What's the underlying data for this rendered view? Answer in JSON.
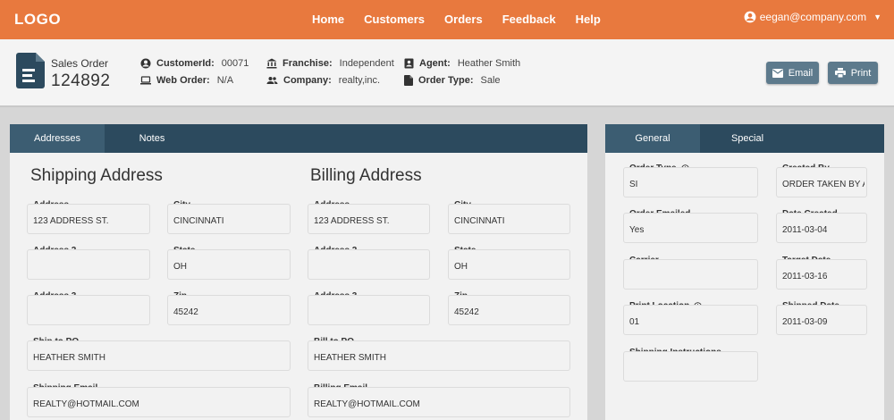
{
  "nav": {
    "logo": "LOGO",
    "links": [
      "Home",
      "Customers",
      "Orders",
      "Feedback",
      "Help"
    ],
    "user_email": "eegan@company.com"
  },
  "order": {
    "type_label": "Sales Order",
    "number": "124892",
    "customer_id": {
      "label": "CustomerId:",
      "value": "00071"
    },
    "web_order": {
      "label": "Web Order:",
      "value": "N/A"
    },
    "franchise": {
      "label": "Franchise:",
      "value": "Independent"
    },
    "company": {
      "label": "Company:",
      "value": "realty,inc."
    },
    "agent": {
      "label": "Agent:",
      "value": "Heather Smith"
    },
    "order_type": {
      "label": "Order Type:",
      "value": "Sale"
    },
    "email_button": "Email",
    "print_button": "Print"
  },
  "left_tabs": [
    "Addresses",
    "Notes"
  ],
  "shipping": {
    "title": "Shipping Address",
    "address_label": "Address",
    "address": "123 ADDRESS ST.",
    "city_label": "City",
    "city": "CINCINNATI",
    "address2_label": "Address 2",
    "address2": "",
    "state_label": "State",
    "state": "OH",
    "address3_label": "Address 3",
    "address3": "",
    "zip_label": "Zip",
    "zip": "45242",
    "po_label": "Ship to PO",
    "po": "HEATHER SMITH",
    "email_label": "Shipping Email",
    "email": "REALTY@HOTMAIL.COM"
  },
  "billing": {
    "title": "Billing Address",
    "address_label": "Address",
    "address": "123 ADDRESS ST.",
    "city_label": "City",
    "city": "CINCINNATI",
    "address2_label": "Address 2",
    "address2": "",
    "state_label": "State",
    "state": "OH",
    "address3_label": "Address 3",
    "address3": "",
    "zip_label": "Zip",
    "zip": "45242",
    "po_label": "Bill to PO",
    "po": "HEATHER SMITH",
    "email_label": "Billing Email",
    "email": "REALTY@HOTMAIL.COM"
  },
  "right_tabs": [
    "General",
    "Special"
  ],
  "general": {
    "order_type_label": "Order Type",
    "order_type": "SI",
    "created_by_label": "Created By",
    "created_by": "ORDER TAKEN BY AM",
    "order_emailed_label": "Order Emailed",
    "order_emailed": "Yes",
    "date_created_label": "Date Created",
    "date_created": "2011-03-04",
    "carrier_label": "Carrier",
    "carrier": "",
    "target_date_label": "Target Date",
    "target_date": "2011-03-16",
    "print_location_label": "Print Location",
    "print_location": "01",
    "shipped_date_label": "Shipped Date",
    "shipped_date": "2011-03-09",
    "shipping_instructions_label": "Shipping Instructions",
    "shipping_instructions": ""
  },
  "colors": {
    "nav": "#e8793e",
    "tabbar": "#2c4a5e",
    "tab_active": "#3c5d72",
    "button": "#5d7a8c"
  }
}
